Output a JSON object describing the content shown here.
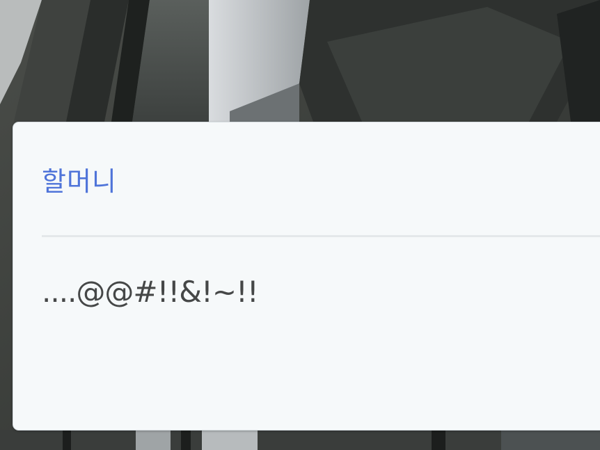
{
  "dialog": {
    "speaker": "할머니",
    "line": "....@@#!!&!~!!"
  },
  "colors": {
    "speaker_name": "#4f74d9",
    "dialog_text": "#454747",
    "panel_background": "#f6f9fa",
    "divider": "#e4e8ea"
  }
}
